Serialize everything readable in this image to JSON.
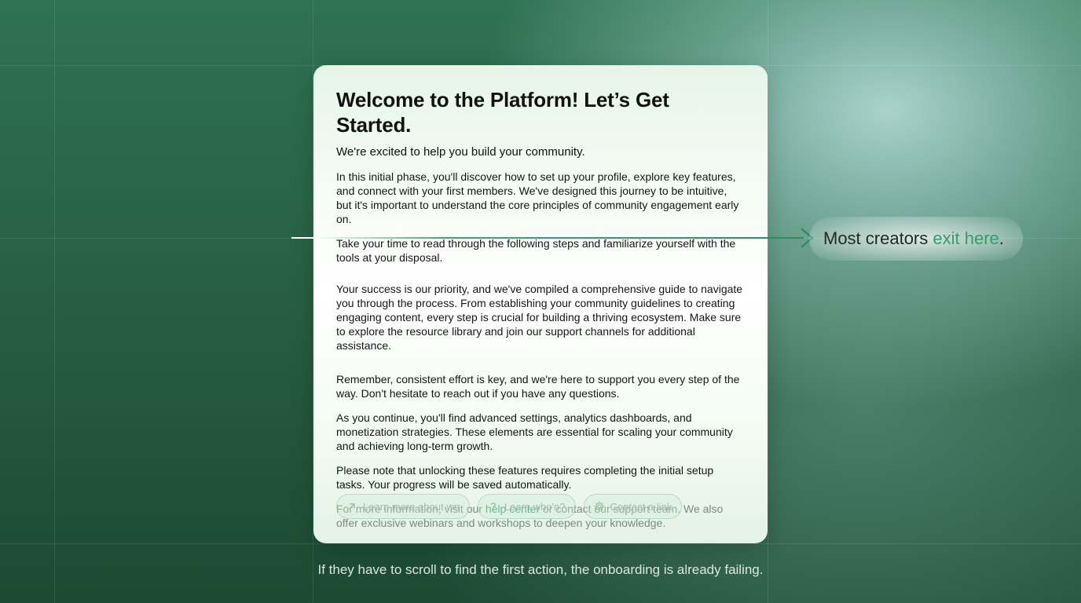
{
  "card": {
    "title": "Welcome to the Platform! Let’s Get Started.",
    "subtitle": "We're excited to help you build your community.",
    "paragraphs": [
      "In this initial phase, you'll discover how to set up your profile, explore key features, and connect with your first members. We've designed this journey to be intuitive, but it's important to understand the core principles of community engagement early on.",
      "Take your time to read through the following steps and familiarize yourself with the tools at your disposal.",
      "Your success is our priority, and we've compiled a comprehensive guide to navigate you through the process. From establishing your community guidelines to creating engaging content, every step is crucial for building a thriving ecosystem. Make sure to explore the resource library and join our support channels for additional assistance.",
      "Remember, consistent effort is key, and we're here to support you every step of the way. Don't hesitate to reach out if you have any questions.",
      "As you continue, you'll find advanced settings, analytics dashboards, and monetization strategies. These elements are essential for scaling your community and achieving long-term growth.",
      "Please note that unlocking these features requires completing the initial setup tasks. Your progress will be saved automatically."
    ],
    "info": {
      "before_link": "For more information, visit our ",
      "link_text": "help center",
      "after_link": " or contact our support team. We also offer exclusive webinars and workshops to deepen your knowledge."
    },
    "actions": [
      {
        "label": "Learn more about wn",
        "icon": "arrow-up-right-icon"
      },
      {
        "label": "Learn who'n?",
        "icon": "question-mark-icon"
      },
      {
        "label": "Contact a link",
        "icon": "gear-icon"
      }
    ]
  },
  "callout": {
    "before": "Most creators ",
    "highlight": "exit here",
    "after": "."
  },
  "caption": "If they have to scroll to find the first action, the onboarding is already failing.",
  "colors": {
    "accent": "#3a9a6c",
    "arrow": "#2e8a5f",
    "background_dark": "#1c4a32"
  }
}
